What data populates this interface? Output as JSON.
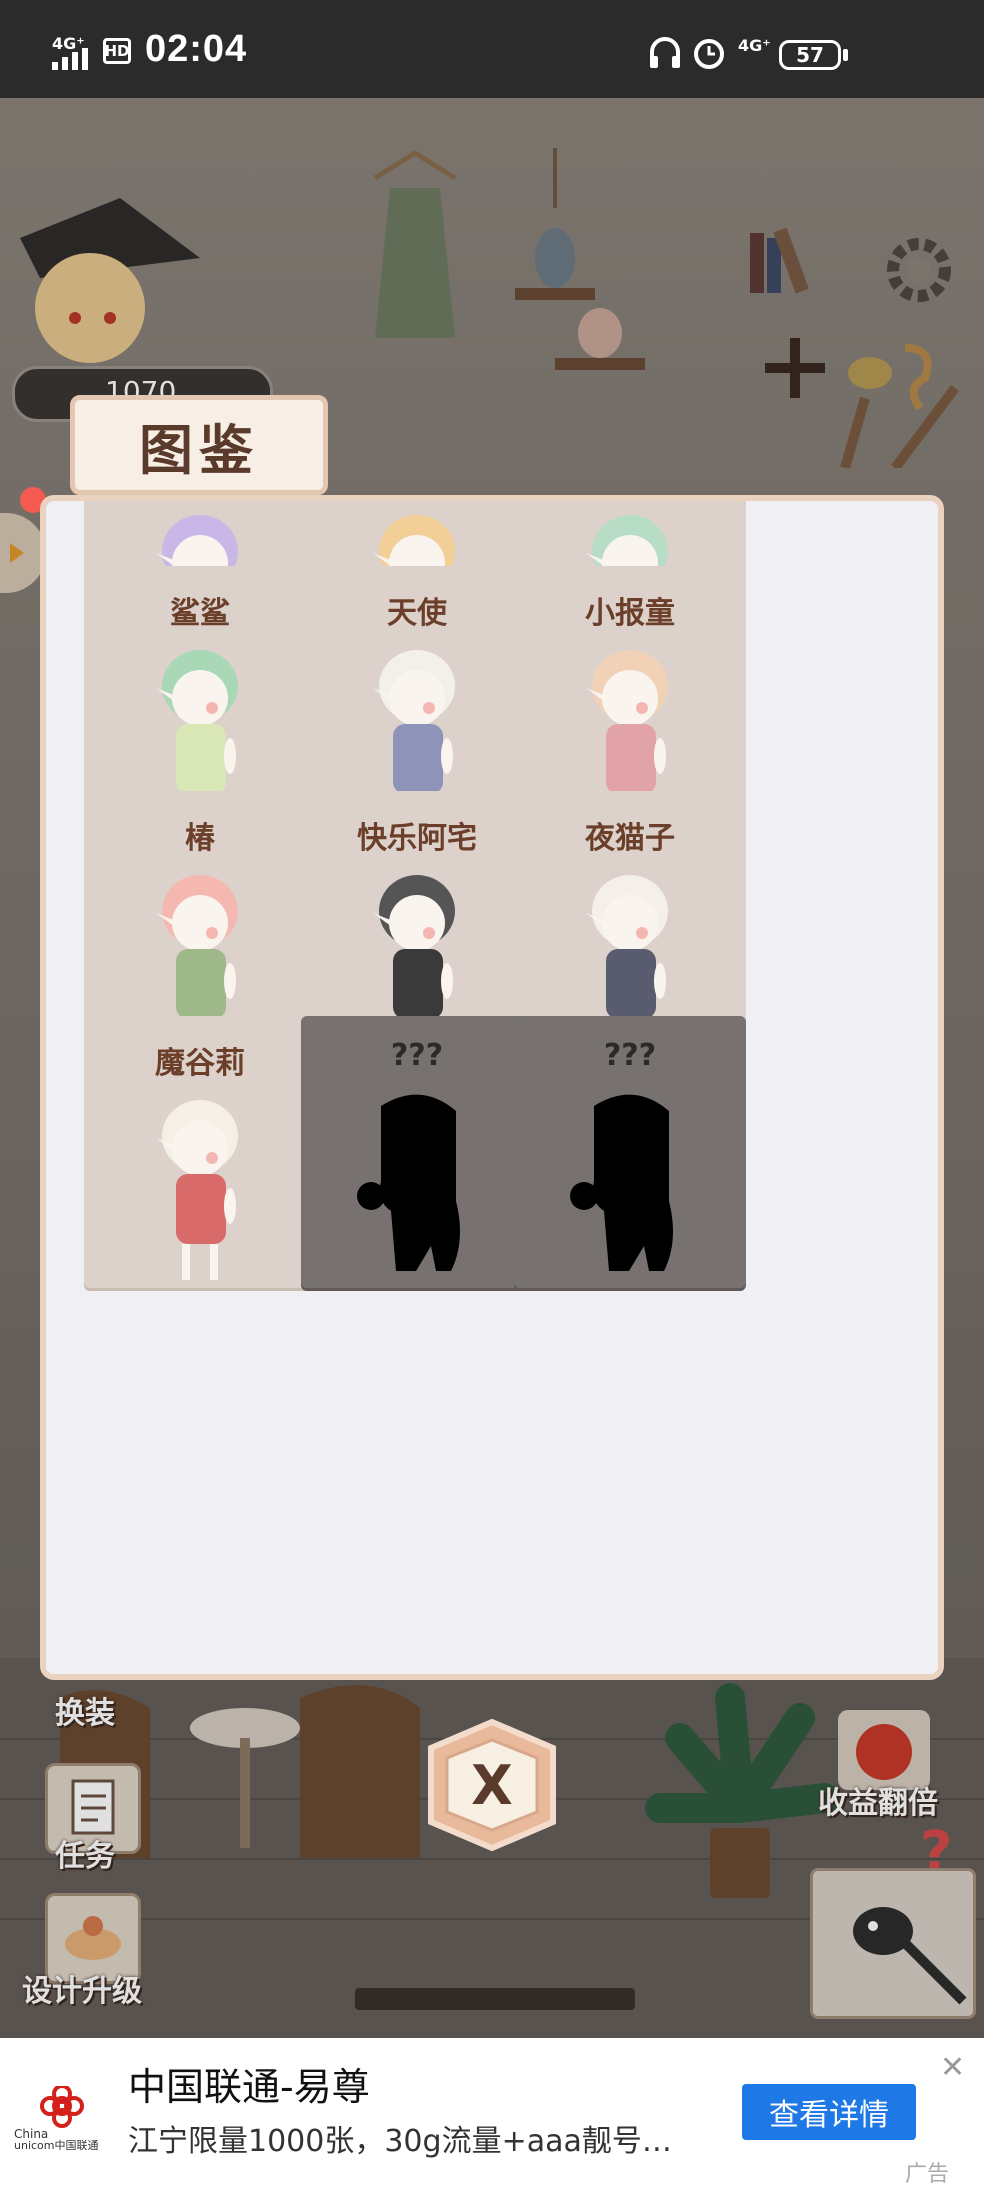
{
  "status_bar": {
    "signal": "4G⁺",
    "hd": "HD",
    "time": "02:04",
    "network": "4G⁺",
    "battery": "57"
  },
  "modal": {
    "title": "图鉴",
    "cards": [
      {
        "name": "",
        "locked": false,
        "hair": "#c9b7e8",
        "body": "#e7e6f1"
      },
      {
        "name": "",
        "locked": false,
        "hair": "#f2cf96",
        "body": "#f3c9a5"
      },
      {
        "name": "",
        "locked": false,
        "hair": "#b8ddc7",
        "body": "#cfe0d2"
      },
      {
        "name": "鲨鲨",
        "locked": false,
        "hair": "#a9d8b6",
        "body": "#d8e7b5"
      },
      {
        "name": "天使",
        "locked": false,
        "hair": "#f3f0ea",
        "body": "#8e93b8"
      },
      {
        "name": "小报童",
        "locked": false,
        "hair": "#f2d2b7",
        "body": "#e1a3a7"
      },
      {
        "name": "椿",
        "locked": false,
        "hair": "#f4b8b0",
        "body": "#9fb88a"
      },
      {
        "name": "快乐阿宅",
        "locked": false,
        "hair": "#555555",
        "body": "#3a3a3a"
      },
      {
        "name": "夜猫子",
        "locked": false,
        "hair": "#f4efe8",
        "body": "#585c6e"
      },
      {
        "name": "魔谷莉",
        "locked": false,
        "hair": "#f5efe6",
        "body": "#d96a6a"
      },
      {
        "name": "???",
        "locked": true
      },
      {
        "name": "???",
        "locked": true
      }
    ]
  },
  "close_button": {
    "label": "X"
  },
  "scene_buttons": {
    "dress_up": "换装",
    "tasks": "任务",
    "design_upgrade": "设计升级",
    "double_income": "收益翻倍",
    "help": "?",
    "coin_value": "1070"
  },
  "ad": {
    "brand_logo_text": "China unicom中国联通",
    "title": "中国联通-易尊",
    "description": "江宁限量1000张，30g流量+aaa靓号…",
    "cta": "查看详情",
    "close": "✕",
    "tag": "广告"
  }
}
